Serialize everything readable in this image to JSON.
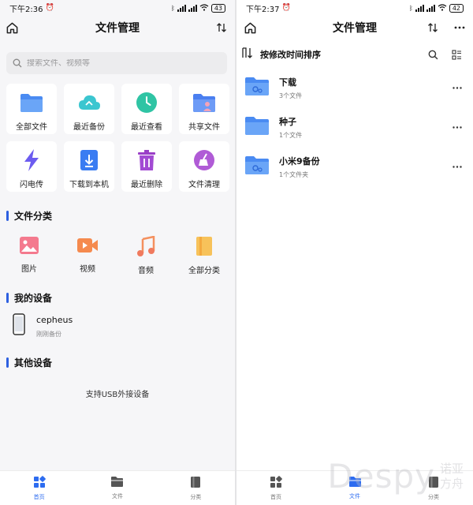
{
  "left": {
    "status": {
      "time": "下午2:36",
      "battery": "43"
    },
    "header": {
      "title": "文件管理"
    },
    "search": {
      "placeholder": "搜索文件、视频等"
    },
    "quick_tiles": [
      {
        "label": "全部文件",
        "icon": "folder-icon"
      },
      {
        "label": "最近备份",
        "icon": "cloud-backup-icon"
      },
      {
        "label": "最近查看",
        "icon": "clock-icon"
      },
      {
        "label": "共享文件",
        "icon": "shared-folder-icon"
      },
      {
        "label": "闪电传",
        "icon": "lightning-icon"
      },
      {
        "label": "下载到本机",
        "icon": "download-icon"
      },
      {
        "label": "最近删除",
        "icon": "trash-icon"
      },
      {
        "label": "文件清理",
        "icon": "broom-icon"
      }
    ],
    "categories_section": {
      "title": "文件分类"
    },
    "categories": [
      {
        "label": "图片",
        "icon": "image-icon"
      },
      {
        "label": "视频",
        "icon": "video-icon"
      },
      {
        "label": "音频",
        "icon": "music-icon"
      },
      {
        "label": "全部分类",
        "icon": "all-categories-icon"
      }
    ],
    "my_devices_section": {
      "title": "我的设备"
    },
    "device": {
      "name": "cepheus",
      "status": "刚刚备份"
    },
    "other_devices_section": {
      "title": "其他设备"
    },
    "usb_text": "支持USB外接设备",
    "bottom_nav": [
      {
        "label": "首页",
        "active": true
      },
      {
        "label": "文件",
        "active": false
      },
      {
        "label": "分类",
        "active": false
      }
    ]
  },
  "right": {
    "status": {
      "time": "下午2:37",
      "battery": "42"
    },
    "header": {
      "title": "文件管理"
    },
    "sort_label": "按修改时间排序",
    "folders": [
      {
        "name": "下载",
        "count": "3个文件"
      },
      {
        "name": "种子",
        "count": "1个文件"
      },
      {
        "name": "小米9备份",
        "count": "1个文件夹"
      }
    ],
    "bottom_nav": [
      {
        "label": "首页",
        "active": false
      },
      {
        "label": "文件",
        "active": true
      },
      {
        "label": "分类",
        "active": false
      }
    ]
  },
  "watermark": {
    "brand": "Despy",
    "cn_line1": "诺亚",
    "cn_line2": "方舟"
  },
  "colors": {
    "accent": "#2d6cf0",
    "folder": "#5b9bf5",
    "background": "#f6f6f8"
  }
}
